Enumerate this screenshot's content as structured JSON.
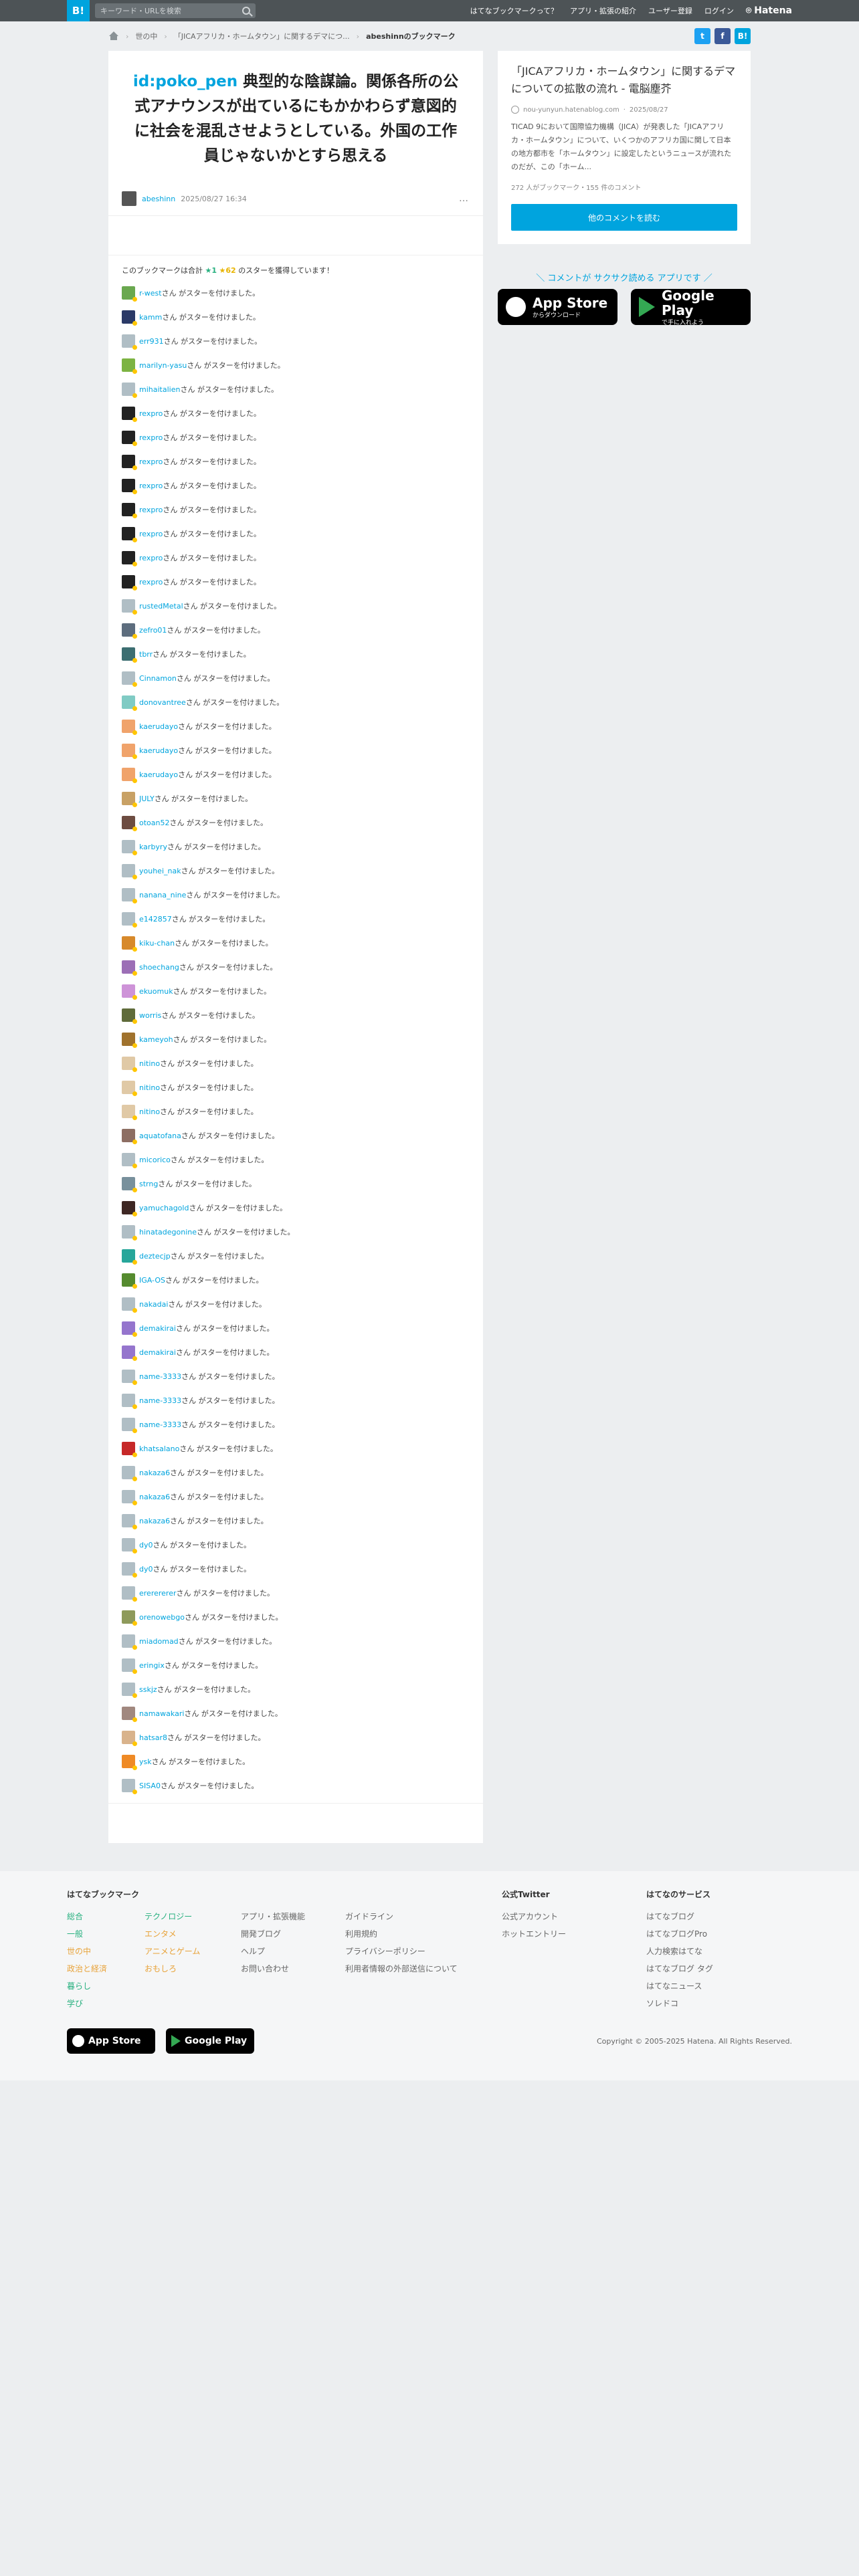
{
  "header": {
    "logo": "B!",
    "search_placeholder": "キーワード・URLを検索",
    "nav": [
      "はてなブックマークって？",
      "アプリ・拡張の紹介",
      "ユーザー登録",
      "ログイン"
    ],
    "hatena": "Hatena"
  },
  "breadcrumb": {
    "items": [
      "世の中",
      "「JICAアフリカ・ホームタウン」に関するデマにつ...",
      "abeshinnのブックマーク"
    ]
  },
  "entry": {
    "user_id": "id:poko_pen",
    "title": " 典型的な陰謀論。関係各所の公式アナウンスが出ているにもかかわらず意図的に社会を混乱させようとしている。外国の工作員じゃないかとすら思える",
    "author": "abeshinn",
    "date": "2025/08/27 16:34",
    "more": "…"
  },
  "stars": {
    "prefix": "このブックマークは合計",
    "green": "★1",
    "yellow": "★62",
    "suffix": "のスターを獲得しています！",
    "suffix_item": "さん がスターを付けました。",
    "users": [
      {
        "name": "r-west",
        "color": "#6aa84f"
      },
      {
        "name": "kamm",
        "color": "#2b3a67"
      },
      {
        "name": "err931",
        "color": "#b0bec5"
      },
      {
        "name": "marilyn-yasu",
        "color": "#7cb342"
      },
      {
        "name": "mihaitalien",
        "color": "#b0bec5"
      },
      {
        "name": "rexpro",
        "color": "#222"
      },
      {
        "name": "rexpro",
        "color": "#222"
      },
      {
        "name": "rexpro",
        "color": "#222"
      },
      {
        "name": "rexpro",
        "color": "#222"
      },
      {
        "name": "rexpro",
        "color": "#222"
      },
      {
        "name": "rexpro",
        "color": "#222"
      },
      {
        "name": "rexpro",
        "color": "#222"
      },
      {
        "name": "rexpro",
        "color": "#222"
      },
      {
        "name": "rustedMetal",
        "color": "#b0bec5"
      },
      {
        "name": "zefro01",
        "color": "#5d6d7e"
      },
      {
        "name": "tbrr",
        "color": "#3c6e71"
      },
      {
        "name": "Cinnamon",
        "color": "#b0bec5"
      },
      {
        "name": "donovantree",
        "color": "#80cbc4"
      },
      {
        "name": "kaerudayo",
        "color": "#f0a36b"
      },
      {
        "name": "kaerudayo",
        "color": "#f0a36b"
      },
      {
        "name": "kaerudayo",
        "color": "#f0a36b"
      },
      {
        "name": "JULY",
        "color": "#c8a165"
      },
      {
        "name": "otoan52",
        "color": "#6d4c41"
      },
      {
        "name": "karbyry",
        "color": "#b0bec5"
      },
      {
        "name": "youhei_nak",
        "color": "#b0bec5"
      },
      {
        "name": "nanana_nine",
        "color": "#b0bec5"
      },
      {
        "name": "e142857",
        "color": "#b0bec5"
      },
      {
        "name": "kiku-chan",
        "color": "#d7892b"
      },
      {
        "name": "shoechang",
        "color": "#9c6fb6"
      },
      {
        "name": "ekuomuk",
        "color": "#ce93d8"
      },
      {
        "name": "worris",
        "color": "#5f6b3a"
      },
      {
        "name": "kameyoh",
        "color": "#a0722d"
      },
      {
        "name": "nitino",
        "color": "#e0c9a6"
      },
      {
        "name": "nitino",
        "color": "#e0c9a6"
      },
      {
        "name": "nitino",
        "color": "#e0c9a6"
      },
      {
        "name": "aquatofana",
        "color": "#8d6e63"
      },
      {
        "name": "micorico",
        "color": "#b0bec5"
      },
      {
        "name": "strng",
        "color": "#78909c"
      },
      {
        "name": "yamuchagold",
        "color": "#3e2723"
      },
      {
        "name": "hinatadegonine",
        "color": "#b0bec5"
      },
      {
        "name": "deztecjp",
        "color": "#26a69a"
      },
      {
        "name": "IGA-OS",
        "color": "#558b2f"
      },
      {
        "name": "nakadai",
        "color": "#b0bec5"
      },
      {
        "name": "demakirai",
        "color": "#9575cd"
      },
      {
        "name": "demakirai",
        "color": "#9575cd"
      },
      {
        "name": "name-3333",
        "color": "#b0bec5"
      },
      {
        "name": "name-3333",
        "color": "#b0bec5"
      },
      {
        "name": "name-3333",
        "color": "#b0bec5"
      },
      {
        "name": "khatsalano",
        "color": "#c62828"
      },
      {
        "name": "nakaza6",
        "color": "#b0bec5"
      },
      {
        "name": "nakaza6",
        "color": "#b0bec5"
      },
      {
        "name": "nakaza6",
        "color": "#b0bec5"
      },
      {
        "name": "dy0",
        "color": "#b0bec5"
      },
      {
        "name": "dy0",
        "color": "#b0bec5"
      },
      {
        "name": "ererererer",
        "color": "#b0bec5"
      },
      {
        "name": "orenowebgo",
        "color": "#8e9a5b"
      },
      {
        "name": "miadomad",
        "color": "#b0bec5"
      },
      {
        "name": "eringix",
        "color": "#b0bec5"
      },
      {
        "name": "sskjz",
        "color": "#b0bec5"
      },
      {
        "name": "namawakari",
        "color": "#a1887f"
      },
      {
        "name": "hatsar8",
        "color": "#d9b38c"
      },
      {
        "name": "ysk",
        "color": "#ef8a26"
      },
      {
        "name": "SISA0",
        "color": "#b0bec5"
      }
    ]
  },
  "side": {
    "title": "「JICAアフリカ・ホームタウン」に関するデマについての拡散の流れ - 電脳塵芥",
    "source": "nou-yunyun.hatenablog.com",
    "date": "2025/08/27",
    "desc": "TICAD 9において国際協力機構（JICA）が発表した「JICAアフリカ・ホームタウン」について、いくつかのアフリカ国に関して日本の地方都市を「ホームタウン」に設定したというニュースが流れたのだが、この「ホーム...",
    "counts": "272 人がブックマーク・155 件のコメント",
    "button": "他のコメントを読む",
    "app_tag": "＼ コメントが サクサク読める アプリです ／",
    "appstore_t1": "App Store",
    "appstore_t2": "からダウンロード",
    "gplay_t1": "Google Play",
    "gplay_t2": "で手に入れよう"
  },
  "footer": {
    "col1_title": "はてなブックマーク",
    "cats1": [
      "総合",
      "一般",
      "世の中",
      "政治と経済",
      "暮らし",
      "学び"
    ],
    "cats2": [
      "テクノロジー",
      "エンタメ",
      "アニメとゲーム",
      "おもしろ"
    ],
    "links1": [
      "アプリ・拡張機能",
      "開発ブログ",
      "ヘルプ",
      "お問い合わせ"
    ],
    "links2": [
      "ガイドライン",
      "利用規約",
      "プライバシーポリシー",
      "利用者情報の外部送信について"
    ],
    "twitter_title": "公式Twitter",
    "twitter": [
      "公式アカウント",
      "ホットエントリー"
    ],
    "services_title": "はてなのサービス",
    "services": [
      "はてなブログ",
      "はてなブログPro",
      "人力検索はてな",
      "はてなブログ タグ",
      "はてなニュース",
      "ソレドコ"
    ],
    "appstore": "App Store",
    "gplay": "Google Play",
    "copyright": "Copyright © 2005-2025 Hatena. All Rights Reserved."
  },
  "colors": {
    "accent": "#00a4de",
    "header_bg": "#4d5356",
    "star_green": "#27b07f",
    "star_yellow": "#e8b400"
  }
}
